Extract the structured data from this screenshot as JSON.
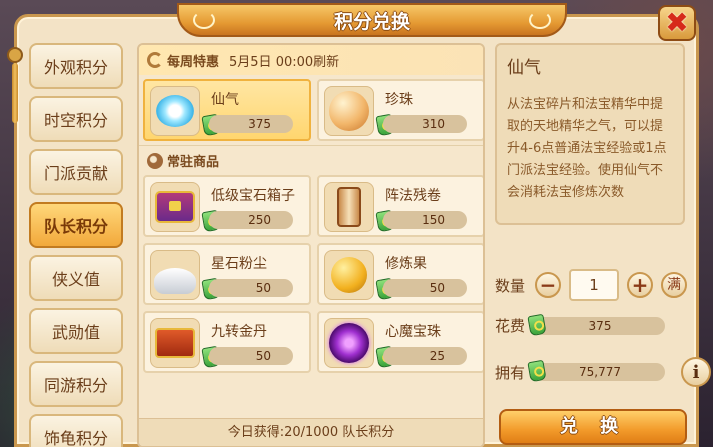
{
  "window": {
    "title": "积分兑换"
  },
  "tabs": [
    {
      "label": "外观积分"
    },
    {
      "label": "时空积分"
    },
    {
      "label": "门派贡献"
    },
    {
      "label": "队长积分",
      "active": true
    },
    {
      "label": "侠义值"
    },
    {
      "label": "武勋值"
    },
    {
      "label": "同游积分"
    },
    {
      "label": "饰龟积分"
    }
  ],
  "weekly": {
    "label": "每周特惠",
    "refresh": "5月5日  00:00刷新",
    "items": [
      {
        "name": "仙气",
        "price": "375",
        "icon": "spirit-energy-icon",
        "selected": true
      },
      {
        "name": "珍珠",
        "price": "310",
        "icon": "pearl-icon"
      }
    ]
  },
  "regular": {
    "label": "常驻商品",
    "items": [
      {
        "name": "低级宝石箱子",
        "price": "250",
        "icon": "gem-chest-icon"
      },
      {
        "name": "阵法残卷",
        "price": "150",
        "icon": "formation-scroll-icon"
      },
      {
        "name": "星石粉尘",
        "price": "50",
        "icon": "star-dust-icon"
      },
      {
        "name": "修炼果",
        "price": "50",
        "icon": "cultivation-fruit-icon"
      },
      {
        "name": "九转金丹",
        "price": "50",
        "icon": "golden-elixir-icon"
      },
      {
        "name": "心魔宝珠",
        "price": "25",
        "icon": "demon-orb-icon"
      }
    ]
  },
  "footer": "今日获得:20/1000 队长积分",
  "detail": {
    "title": "仙气",
    "description": "从法宝碎片和法宝精华中提取的天地精华之气，可以提升4-6点普通法宝经验或1点门派法宝经验。使用仙气不会消耗法宝修炼次数"
  },
  "quantity": {
    "label": "数量",
    "value": "1",
    "minus": "−",
    "plus": "+",
    "max": "满"
  },
  "cost": {
    "label": "花费",
    "value": "375"
  },
  "owned": {
    "label": "拥有",
    "value": "75,777",
    "info": "i"
  },
  "exchange_button": "兑 换",
  "colors": {
    "accent": "#f29a2a",
    "panel": "#f3e3c6",
    "text": "#6b3e1a"
  }
}
